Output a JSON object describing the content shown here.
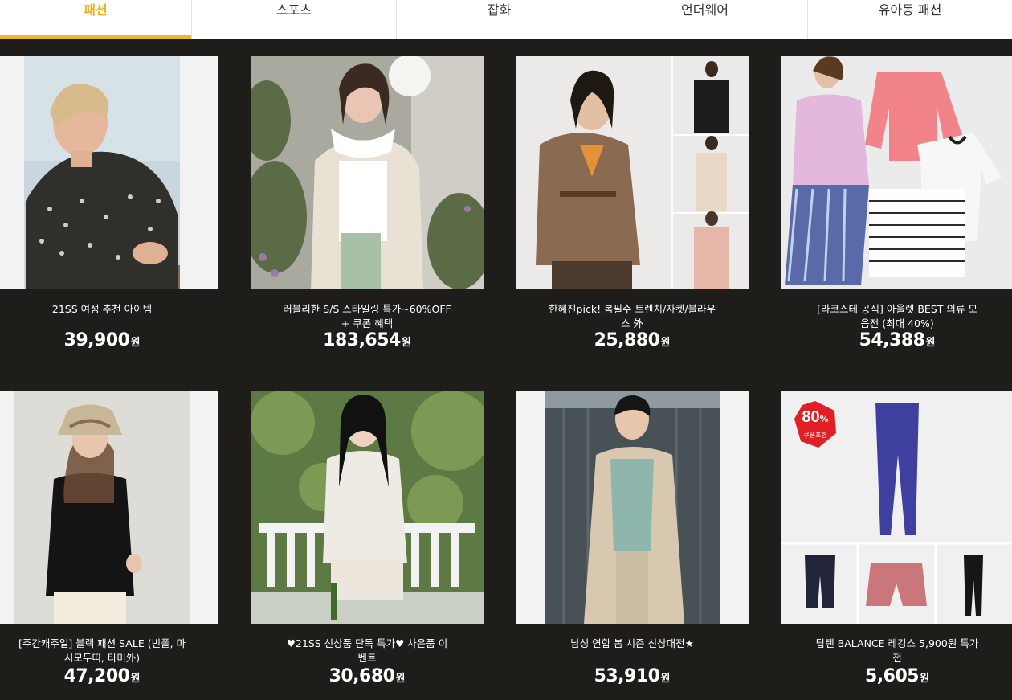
{
  "tabs": [
    {
      "label": "패션",
      "active": true
    },
    {
      "label": "스포츠",
      "active": false
    },
    {
      "label": "잡화",
      "active": false
    },
    {
      "label": "언더웨어",
      "active": false
    },
    {
      "label": "유아동 패션",
      "active": false
    }
  ],
  "products": [
    {
      "title": "21SS 여성 추천 아이템",
      "price": "39,900",
      "unit": "원"
    },
    {
      "title": "러블리한 S/S 스타일링 특가~60%OFF + 쿠폰 혜택",
      "price": "183,654",
      "unit": "원"
    },
    {
      "title": "한혜진pick! 봄필수 트렌치/자켓/블라우스 外",
      "price": "25,880",
      "unit": "원"
    },
    {
      "title": "[라코스테 공식] 아울렛 BEST 의류 모음전 (최대 40%)",
      "price": "54,388",
      "unit": "원"
    },
    {
      "title": "[주간캐주얼] 블랙 패션 SALE (빈폴, 마시모두띠, 타미外)",
      "price": "47,200",
      "unit": "원"
    },
    {
      "title": "♥21SS 신상품 단독 특가♥ 사은품 이벤트",
      "price": "30,680",
      "unit": "원"
    },
    {
      "title": "남성 연합 봄 시즌 신상대전★",
      "price": "53,910",
      "unit": "원"
    },
    {
      "title": "탑텐 BALANCE 레깅스 5,900원 특가전",
      "price": "5,605",
      "unit": "원"
    }
  ],
  "badge": {
    "percent": "80",
    "sign": "%",
    "caption": "쿠폰포함"
  },
  "colors": {
    "accent": "#f2b824",
    "background": "#1e1d1a",
    "badge": "#e01f26"
  }
}
